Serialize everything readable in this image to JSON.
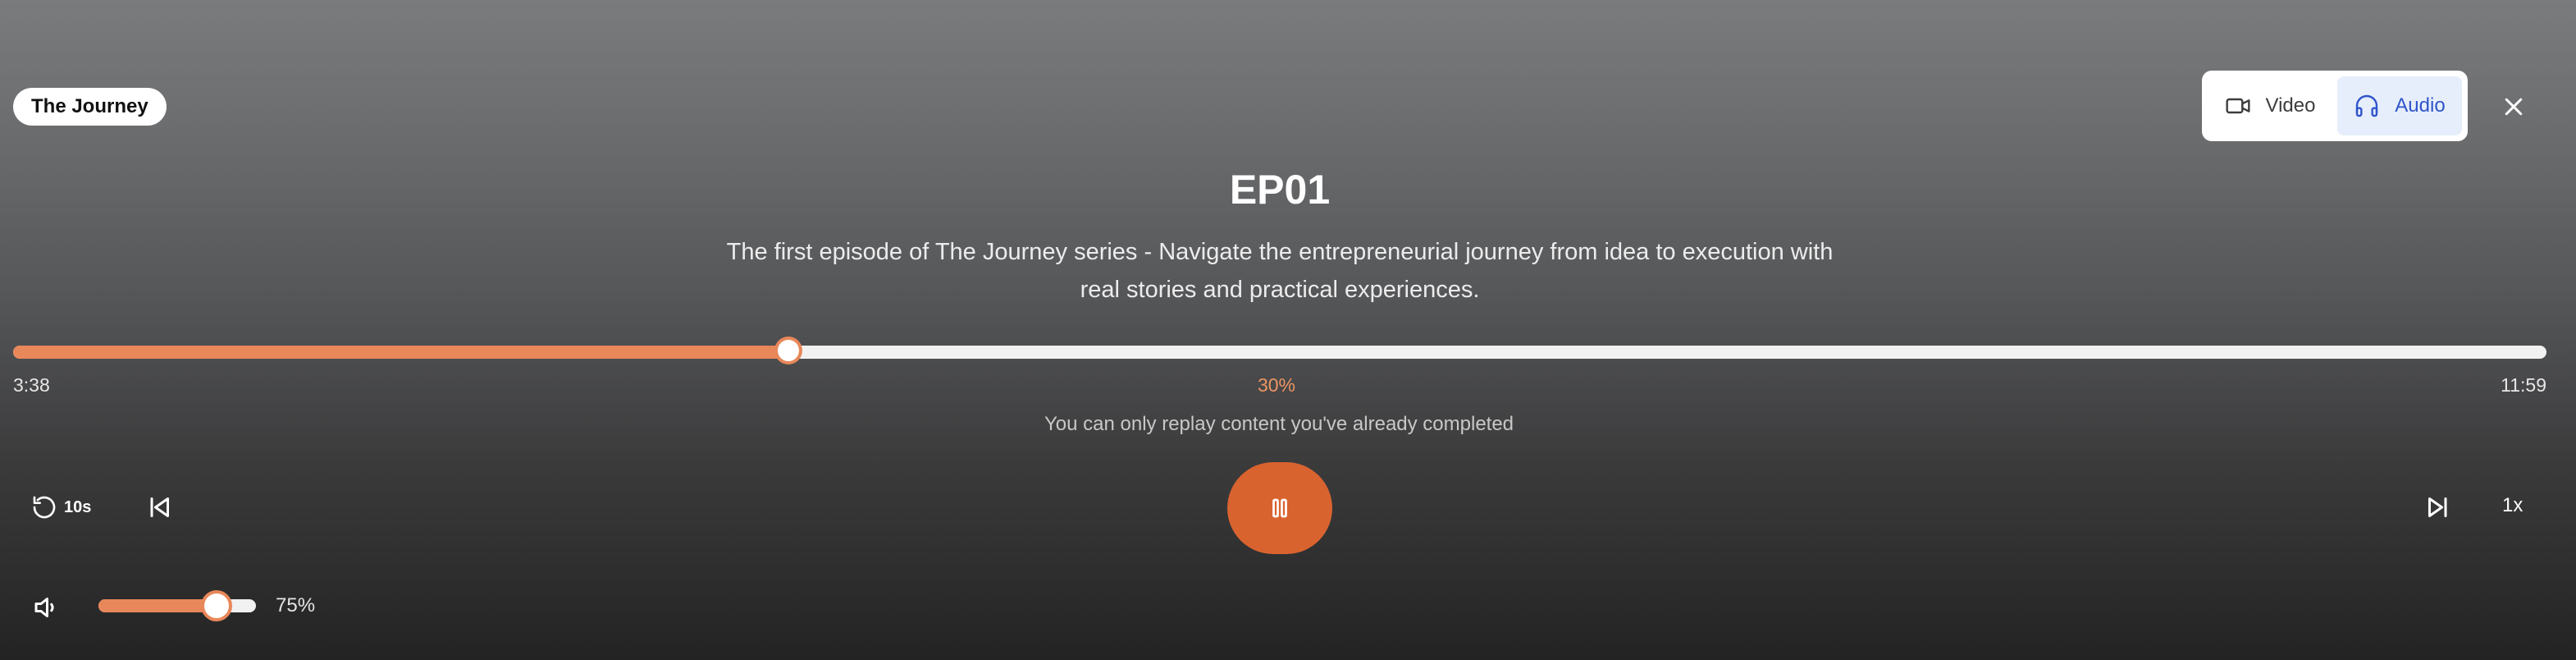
{
  "series": {
    "name": "The Journey"
  },
  "mode_switch": {
    "options": [
      {
        "label": "Video",
        "icon": "video-camera-icon",
        "active": false
      },
      {
        "label": "Audio",
        "icon": "headphones-icon",
        "active": true
      }
    ]
  },
  "close": {
    "icon": "close-icon"
  },
  "episode": {
    "title": "EP01",
    "description": "The first episode of The Journey series - Navigate the entrepreneurial journey from idea to execution with real stories and practical experiences."
  },
  "progress": {
    "fraction": 0.306,
    "current_time": "3:38",
    "total_time": "11:59",
    "percent_label": "30%",
    "note": "You can only replay content you've already completed"
  },
  "controls": {
    "rewind_label": "10s",
    "rewind_icon": "rewind-icon",
    "prev_icon": "skip-previous-icon",
    "play_icon": "pause-icon",
    "next_icon": "skip-next-icon",
    "speed_label": "1x"
  },
  "volume": {
    "icon": "volume-icon",
    "fraction": 0.75,
    "percent_label": "75%"
  },
  "colors": {
    "accent": "#e8875a",
    "play_button": "#d9632f",
    "active_mode_bg": "#e6eefb",
    "active_mode_text": "#2f55c9"
  }
}
